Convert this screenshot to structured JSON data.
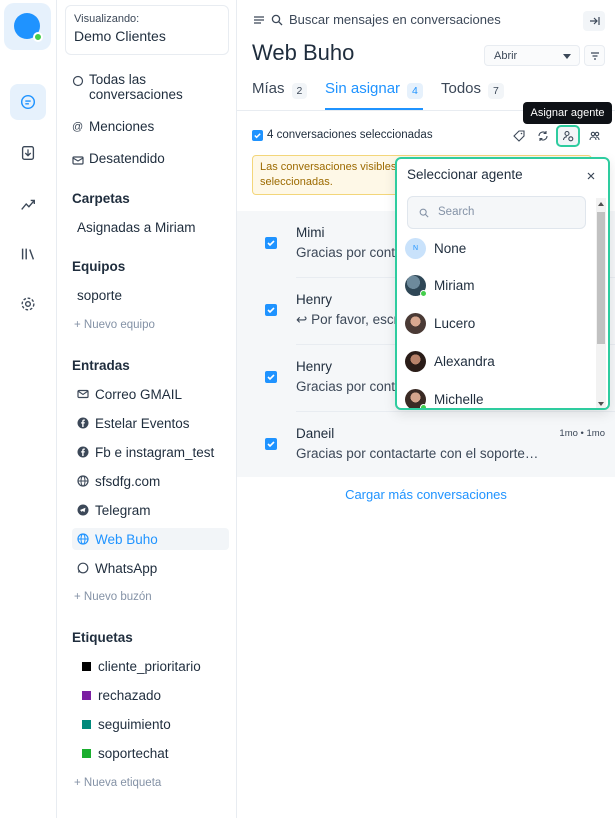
{
  "account": {
    "label": "Visualizando:",
    "name": "Demo Clientes"
  },
  "nav": {
    "all": "Todas las conversaciones",
    "mentions": "Menciones",
    "unattended": "Desatendido"
  },
  "folders": {
    "title": "Carpetas",
    "items": [
      "Asignadas a Miriam"
    ]
  },
  "teams": {
    "title": "Equipos",
    "items": [
      "soporte"
    ],
    "add": "Nuevo equipo"
  },
  "inboxes": {
    "title": "Entradas",
    "items": [
      {
        "label": "Correo GMAIL",
        "icon": "mail-icon"
      },
      {
        "label": "Estelar Eventos",
        "icon": "facebook-icon"
      },
      {
        "label": "Fb e instagram_test",
        "icon": "facebook-icon"
      },
      {
        "label": "sfsdfg.com",
        "icon": "globe-icon"
      },
      {
        "label": "Telegram",
        "icon": "telegram-icon"
      },
      {
        "label": "Web Buho",
        "icon": "globe-icon"
      },
      {
        "label": "WhatsApp",
        "icon": "whatsapp-icon"
      }
    ],
    "add": "Nuevo buzón"
  },
  "labels": {
    "title": "Etiquetas",
    "items": [
      {
        "label": "cliente_prioritario",
        "color": "#000000"
      },
      {
        "label": "rechazado",
        "color": "#7b1fa2"
      },
      {
        "label": "seguimiento",
        "color": "#00897b"
      },
      {
        "label": "soportechat",
        "color": "#1aae2e"
      }
    ],
    "add": "Nueva etiqueta"
  },
  "header": {
    "search_placeholder": "Buscar mensajes en conversaciones",
    "title": "Web Buho",
    "status": "Abrir"
  },
  "tabs": [
    {
      "label": "Mías",
      "count": "2"
    },
    {
      "label": "Sin asignar",
      "count": "4"
    },
    {
      "label": "Todos",
      "count": "7"
    }
  ],
  "bulk": {
    "selected": "4 conversaciones seleccionadas",
    "tooltip": "Asignar agente",
    "warning": "Las conversaciones visibles en esta página solo están seleccionadas."
  },
  "conversations": [
    {
      "name": "Mimi",
      "message": "Gracias por contactarte con el soporte…",
      "time": ""
    },
    {
      "name": "Henry",
      "message": "Por favor, escríbenos un poco más…",
      "time": ""
    },
    {
      "name": "Henry",
      "message": "Gracias por contactarte con el soporte…",
      "time": ""
    },
    {
      "name": "Daneil",
      "message": "Gracias por contactarte con el soporte…",
      "time": "1mo • 1mo"
    }
  ],
  "load_more": "Cargar más conversaciones",
  "agent_dropdown": {
    "title": "Seleccionar agente",
    "search_placeholder": "Search",
    "agents": [
      "None",
      "Miriam",
      "Lucero",
      "Alexandra",
      "Michelle"
    ]
  },
  "colors": {
    "accent": "#1f93ff",
    "highlight": "#2ecc9f",
    "online": "#44ce4b"
  }
}
